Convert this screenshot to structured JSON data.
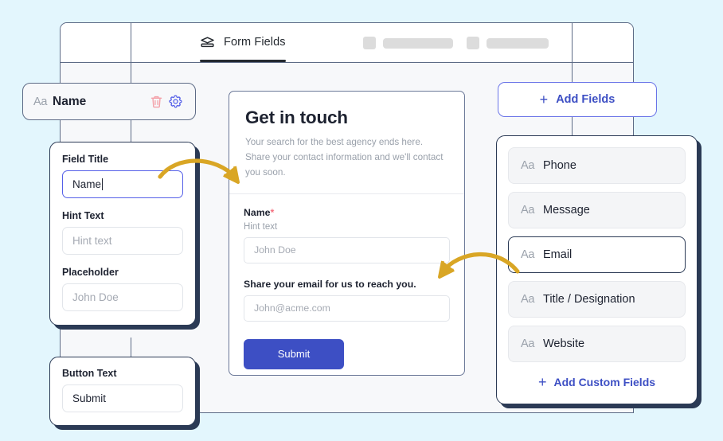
{
  "app": {
    "background_color": "#e3f6fd",
    "accent_color": "#3d4fc4",
    "card_border_color": "#2b3a55"
  },
  "tabbar": {
    "active_tab": {
      "label": "Form Fields",
      "icon": "layers-icon"
    },
    "placeholder_tabs": [
      {
        "icon": "placeholder-square",
        "bar": "placeholder-bar"
      },
      {
        "icon": "placeholder-square",
        "bar": "placeholder-bar"
      }
    ]
  },
  "field_pill": {
    "type_icon": "Aa",
    "label": "Name",
    "delete_icon": "trash-icon",
    "settings_icon": "gear-icon",
    "delete_color": "#f4a0a8",
    "settings_color": "#5560e8"
  },
  "settings_panel": {
    "fields": [
      {
        "label": "Field Title",
        "value": "Name",
        "placeholder": "",
        "focused": true
      },
      {
        "label": "Hint Text",
        "value": "",
        "placeholder": "Hint text",
        "focused": false
      },
      {
        "label": "Placeholder",
        "value": "",
        "placeholder": "John Doe",
        "focused": false
      }
    ]
  },
  "button_panel": {
    "label": "Button Text",
    "value": "Submit"
  },
  "preview": {
    "title": "Get in touch",
    "subtitle": "Your search for the best agency ends here. Share your contact information and we'll contact you soon.",
    "fields": [
      {
        "label": "Name",
        "required_marker": "*",
        "hint": "Hint text",
        "placeholder": "John Doe"
      },
      {
        "label": "Share your email for us to reach you.",
        "required_marker": "",
        "hint": "",
        "placeholder": "John@acme.com"
      }
    ],
    "submit_label": "Submit"
  },
  "right_panel": {
    "add_fields_label": "Add Fields",
    "add_fields_plus": "+",
    "field_items": [
      {
        "type_icon": "Aa",
        "label": "Phone",
        "selected": false
      },
      {
        "type_icon": "Aa",
        "label": "Message",
        "selected": false
      },
      {
        "type_icon": "Aa",
        "label": "Email",
        "selected": true
      },
      {
        "type_icon": "Aa",
        "label": "Title / Designation",
        "selected": false
      },
      {
        "type_icon": "Aa",
        "label": "Website",
        "selected": false
      }
    ],
    "add_custom_label": "Add Custom Fields",
    "add_custom_plus": "+"
  },
  "annotations": {
    "arrow_color": "#d9a625",
    "arrows": [
      {
        "name": "field-title-to-preview-label"
      },
      {
        "name": "email-item-to-preview-email"
      }
    ]
  }
}
